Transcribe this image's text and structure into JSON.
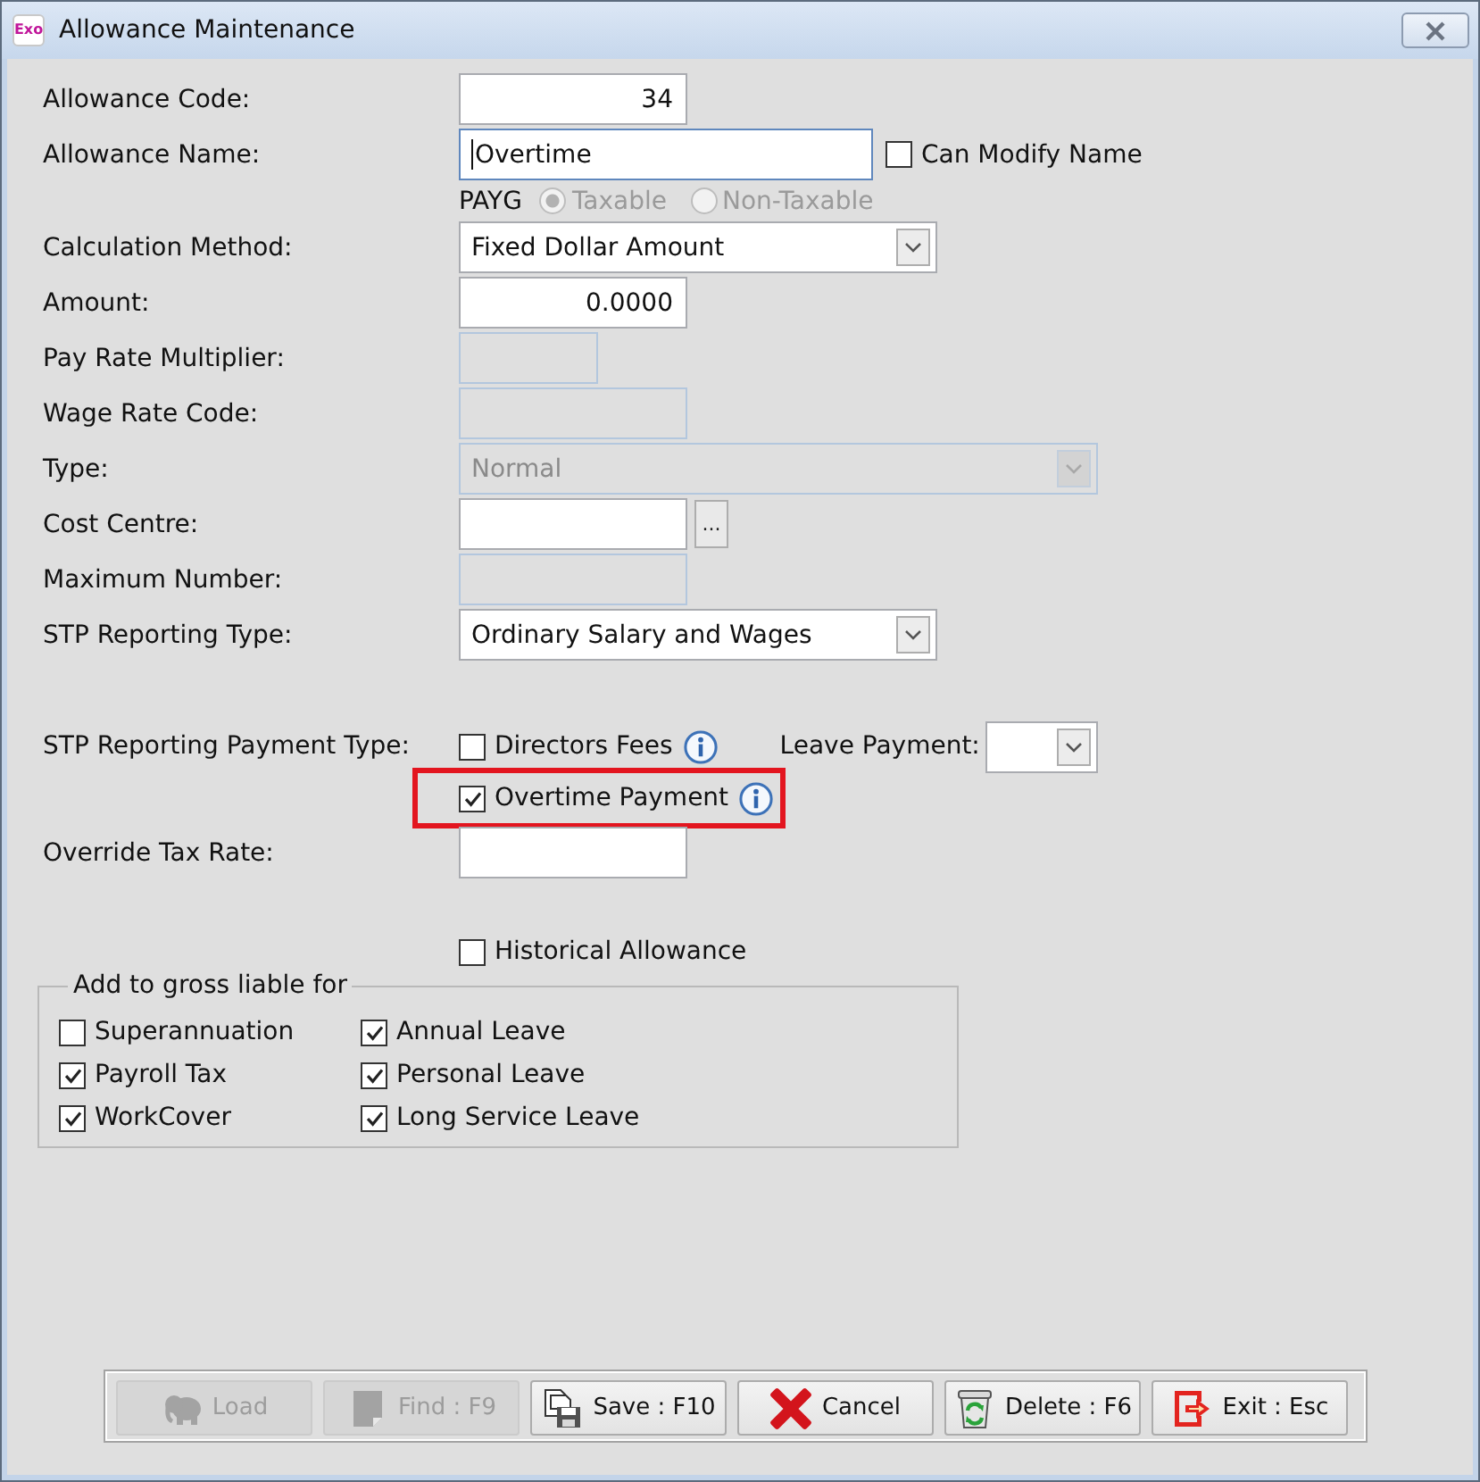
{
  "window": {
    "title": "Allowance Maintenance",
    "logo": "Exo"
  },
  "form": [
    {
      "kind": "number",
      "label": "Allowance Code:",
      "value": "34",
      "disabled": false,
      "focused": false
    },
    {
      "kind": "text",
      "label": "Allowance Name:",
      "value": "Overtime",
      "disabled": false,
      "focused": true,
      "checkbox": {
        "label": "Can Modify Name",
        "checked": false
      }
    },
    {
      "kind": "radios",
      "label": "PAYG",
      "options": [
        {
          "label": "Taxable",
          "selected": true,
          "disabled": true
        },
        {
          "label": "Non-Taxable",
          "selected": false,
          "disabled": true
        }
      ]
    },
    {
      "kind": "select",
      "label": "Calculation Method:",
      "value": "Fixed Dollar Amount",
      "disabled": false,
      "focused": false
    },
    {
      "kind": "number",
      "label": "Amount:",
      "value": "0.0000",
      "disabled": false,
      "focused": false
    },
    {
      "kind": "text",
      "label": "Pay Rate Multiplier:",
      "disabled": true,
      "focused": false
    },
    {
      "kind": "text",
      "label": "Wage Rate Code:",
      "disabled": true,
      "focused": false
    },
    {
      "kind": "select",
      "label": "Type:",
      "value": "Normal",
      "disabled": true,
      "focused": false
    },
    {
      "kind": "lookup",
      "label": "Cost Centre:",
      "button": "...",
      "disabled": false,
      "focused": false
    },
    {
      "kind": "text",
      "label": "Maximum Number:",
      "disabled": true,
      "focused": false
    },
    {
      "kind": "select",
      "label": "STP Reporting Type:",
      "value": "Ordinary Salary and Wages",
      "disabled": false,
      "focused": false
    }
  ],
  "payment_type": {
    "label": "STP Reporting Payment Type:",
    "options": [
      {
        "label": "Directors Fees",
        "checked": false,
        "highlighted": false
      },
      {
        "label": "Overtime Payment",
        "checked": true,
        "highlighted": true
      }
    ],
    "leave_payment": {
      "label": "Leave Payment:",
      "disabled": false
    }
  },
  "override_tax_rate": {
    "label": "Override Tax Rate:",
    "disabled": false
  },
  "historical_allowance": {
    "label": "Historical Allowance",
    "checked": false
  },
  "gross_liable": {
    "title": "Add to gross liable for",
    "items": [
      {
        "label": "Superannuation",
        "checked": false
      },
      {
        "label": "Payroll Tax",
        "checked": true
      },
      {
        "label": "WorkCover",
        "checked": true
      },
      {
        "label": "Annual Leave",
        "checked": true
      },
      {
        "label": "Personal Leave",
        "checked": true
      },
      {
        "label": "Long Service Leave",
        "checked": true
      }
    ]
  },
  "buttons": [
    {
      "kind": "load",
      "label": "Load",
      "disabled": true
    },
    {
      "kind": "find",
      "label": "Find : F9",
      "disabled": true
    },
    {
      "kind": "save",
      "label": "Save : F10",
      "disabled": false
    },
    {
      "kind": "cancel",
      "label": "Cancel",
      "disabled": false
    },
    {
      "kind": "delete",
      "label": "Delete : F6",
      "disabled": false
    },
    {
      "kind": "exit",
      "label": "Exit : Esc",
      "disabled": false
    }
  ]
}
